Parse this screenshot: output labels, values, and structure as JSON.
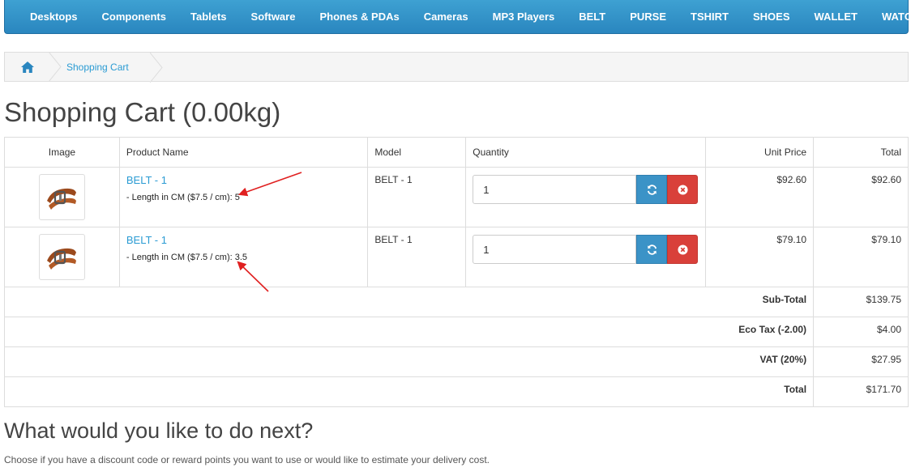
{
  "nav": {
    "items": [
      "Desktops",
      "Components",
      "Tablets",
      "Software",
      "Phones & PDAs",
      "Cameras",
      "MP3 Players",
      "BELT",
      "PURSE",
      "TSHIRT",
      "SHOES",
      "WALLET",
      "WATCH"
    ]
  },
  "breadcrumb": {
    "home_icon": "home-icon",
    "items": [
      "Shopping Cart"
    ]
  },
  "page": {
    "title": "Shopping Cart (0.00kg)"
  },
  "cart": {
    "headers": {
      "image": "Image",
      "product_name": "Product Name",
      "model": "Model",
      "quantity": "Quantity",
      "unit_price": "Unit Price",
      "total": "Total"
    },
    "items": [
      {
        "name": "BELT - 1",
        "option": "- Length in CM ($7.5 / cm): 5",
        "model": "BELT - 1",
        "quantity": "1",
        "unit_price": "$92.60",
        "total": "$92.60"
      },
      {
        "name": "BELT - 1",
        "option": "- Length in CM ($7.5 / cm): 3.5",
        "model": "BELT - 1",
        "quantity": "1",
        "unit_price": "$79.10",
        "total": "$79.10"
      }
    ],
    "totals": [
      {
        "label": "Sub-Total",
        "value": "$139.75"
      },
      {
        "label": "Eco Tax (-2.00)",
        "value": "$4.00"
      },
      {
        "label": "VAT (20%)",
        "value": "$27.95"
      },
      {
        "label": "Total",
        "value": "$171.70"
      }
    ]
  },
  "next": {
    "title": "What would you like to do next?",
    "text": "Choose if you have a discount code or reward points you want to use or would like to estimate your delivery cost."
  },
  "colors": {
    "nav_bg": "#2a86bf",
    "link": "#2a9bd3",
    "refresh_button": "#3b93c7",
    "remove_button": "#d9403a",
    "annotation_arrow": "#e02020"
  },
  "icons": {
    "refresh": "refresh-icon",
    "remove": "remove-icon",
    "product": "belt-product-image"
  }
}
